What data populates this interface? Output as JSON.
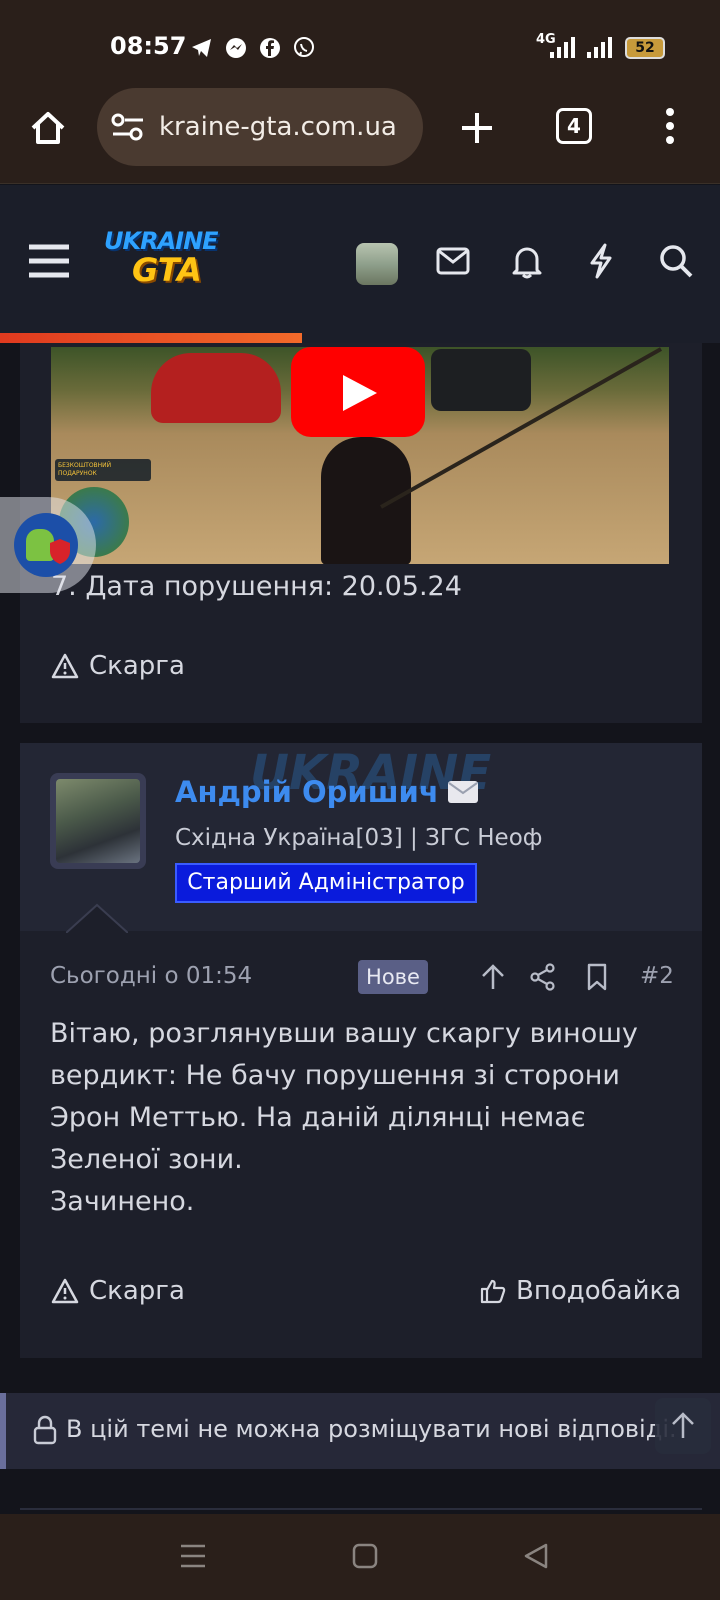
{
  "status_bar": {
    "time": "08:57",
    "icons": [
      "telegram-icon",
      "messenger-icon",
      "facebook-icon",
      "viber-icon"
    ],
    "network": "4G",
    "battery": "52"
  },
  "browser": {
    "url": "kraine-gta.com.ua",
    "tab_count": "4"
  },
  "site": {
    "logo_line1": "UKRAINE",
    "logo_line2": "GTA"
  },
  "post1": {
    "item_text": "7. Дата порушення: 20.05.24",
    "report_label": "Скарга",
    "video_overlay_text": "БЕЗКОШТОВНИЙ ПОДАРУНОК"
  },
  "post2": {
    "author": "Андрій Оришич",
    "region": "Східна Україна[03] | ЗГС Неоф",
    "role": "Старший Адміністратор",
    "date": "Сьогодні о 01:54",
    "badge": "Нове",
    "number": "#2",
    "body": [
      "Вітаю, розглянувши вашу скаргу виношу",
      "вердикт: Не бачу порушення зі сторони",
      "Эрон Меттью. На даній ділянці немає",
      "Зеленої зони.",
      "Зачинено."
    ],
    "report_label": "Скарга",
    "like_label": "Вподобайка"
  },
  "locked_notice": "В цій темі не можна розміщувати нові відповіді.",
  "colors": {
    "accent_blue": "#3d8bef",
    "role_badge": "#0a1bdc",
    "progress": "#e8461f",
    "new_badge": "#5a5f86"
  }
}
